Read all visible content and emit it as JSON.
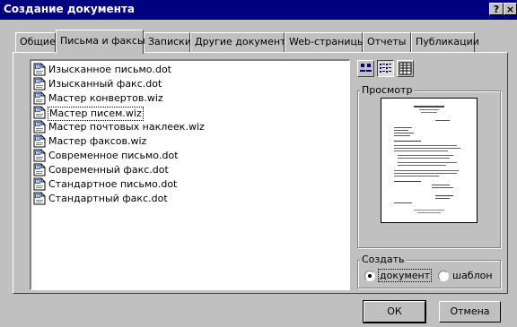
{
  "window": {
    "title": "Создание документа",
    "help_button": "?",
    "close_button": "×"
  },
  "tabs": [
    {
      "label": "Общие",
      "active": false
    },
    {
      "label": "Письма и факсы",
      "active": true
    },
    {
      "label": "Записки",
      "active": false
    },
    {
      "label": "Другие документы",
      "active": false
    },
    {
      "label": "Web-страницы",
      "active": false
    },
    {
      "label": "Отчеты",
      "active": false
    },
    {
      "label": "Публикации",
      "active": false
    }
  ],
  "templates": [
    {
      "name": "Изысканное письмо.dot",
      "icon": "word-template-icon",
      "selected": false
    },
    {
      "name": "Изысканный факс.dot",
      "icon": "word-template-icon",
      "selected": false
    },
    {
      "name": "Мастер конвертов.wiz",
      "icon": "word-wizard-icon",
      "selected": false
    },
    {
      "name": "Мастер писем.wiz",
      "icon": "word-wizard-icon",
      "selected": true
    },
    {
      "name": "Мастер почтовых наклеек.wiz",
      "icon": "word-wizard-icon",
      "selected": false
    },
    {
      "name": "Мастер факсов.wiz",
      "icon": "word-wizard-icon",
      "selected": false
    },
    {
      "name": "Современное письмо.dot",
      "icon": "word-template-icon",
      "selected": false
    },
    {
      "name": "Современный факс.dot",
      "icon": "word-template-icon",
      "selected": false
    },
    {
      "name": "Стандартное письмо.dot",
      "icon": "word-template-icon",
      "selected": false
    },
    {
      "name": "Стандартный факс.dot",
      "icon": "word-template-icon",
      "selected": false
    }
  ],
  "view_buttons": [
    {
      "name": "large-icons-view-icon",
      "pressed": false
    },
    {
      "name": "list-view-icon",
      "pressed": true
    },
    {
      "name": "details-view-icon",
      "pressed": false
    }
  ],
  "preview": {
    "label": "Просмотр"
  },
  "create": {
    "label": "Создать",
    "options": [
      {
        "label": "документ",
        "checked": true
      },
      {
        "label": "шаблон",
        "checked": false
      }
    ]
  },
  "buttons": {
    "ok": "ОК",
    "cancel": "Отмена"
  },
  "colors": {
    "titlebar": "#000080",
    "face": "#c0c0c0",
    "selection_border": "#000000"
  }
}
